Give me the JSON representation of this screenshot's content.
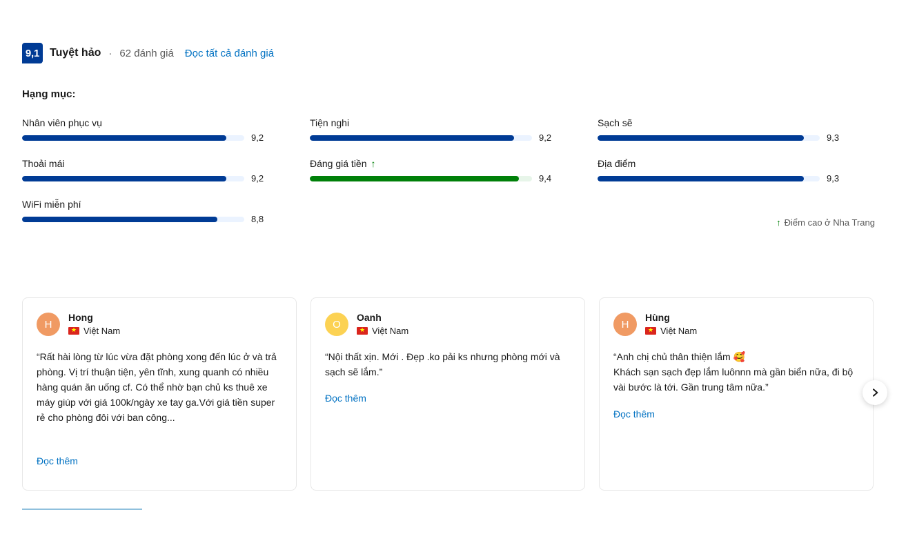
{
  "header": {
    "score": "9,1",
    "score_word": "Tuyệt hảo",
    "separator": "·",
    "review_count": "62 đánh giá",
    "all_reviews_link": "Đọc tất cả đánh giá"
  },
  "categories": {
    "title": "Hạng mục:",
    "items": [
      {
        "label": "Nhân viên phục vụ",
        "value": "9,2",
        "percent": 92,
        "color": "blue",
        "badge": ""
      },
      {
        "label": "Tiện nghi",
        "value": "9,2",
        "percent": 92,
        "color": "blue",
        "badge": ""
      },
      {
        "label": "Sạch sẽ",
        "value": "9,3",
        "percent": 93,
        "color": "blue",
        "badge": ""
      },
      {
        "label": "Thoải mái",
        "value": "9,2",
        "percent": 92,
        "color": "blue",
        "badge": ""
      },
      {
        "label": "Đáng giá tiền",
        "value": "9,4",
        "percent": 94,
        "color": "green",
        "badge": "arrow-up-icon"
      },
      {
        "label": "Địa điểm",
        "value": "9,3",
        "percent": 93,
        "color": "blue",
        "badge": ""
      },
      {
        "label": "WiFi miễn phí",
        "value": "8,8",
        "percent": 88,
        "color": "blue",
        "badge": ""
      }
    ],
    "high_score_note": "Điểm cao ở Nha Trang"
  },
  "reviews": [
    {
      "initial": "H",
      "avatar_color": "#f09a63",
      "name": "Hong",
      "country": "Việt Nam",
      "text": "“Rất hài lòng từ lúc vừa đặt phòng xong đến lúc ở và trả phòng. Vị trí thuận tiện, yên tĩnh, xung quanh có nhiều hàng quán ăn uống cf. Có thể nhờ bạn chủ ks thuê xe máy giúp với giá 100k/ngày xe tay ga.Với giá tiền super rẻ cho phòng đôi với ban công...",
      "read_more": "Đọc thêm"
    },
    {
      "initial": "O",
      "avatar_color": "#fcd253",
      "name": "Oanh",
      "country": "Việt Nam",
      "text": "“Nội thất xịn. Mới . Đẹp .ko pải ks nhưng phòng mới và sạch sẽ lắm.”",
      "read_more": "Đọc thêm"
    },
    {
      "initial": "H",
      "avatar_color": "#f09a63",
      "name": "Hùng",
      "country": "Việt Nam",
      "text": "“Anh chị chủ thân thiện lắm 🥰\nKhách sạn sạch đẹp lắm luônnn mà gần biển nữa, đi bộ vài bước là tới. Gần trung tâm nữa.”",
      "read_more": "Đọc thêm"
    }
  ],
  "carousel": {
    "next_icon": "chevron-right-icon"
  },
  "colors": {
    "brand_blue": "#003b95",
    "link_blue": "#0071c2",
    "green": "#008009",
    "track_blue": "#ebf3ff",
    "track_green": "#e7f5e9"
  }
}
